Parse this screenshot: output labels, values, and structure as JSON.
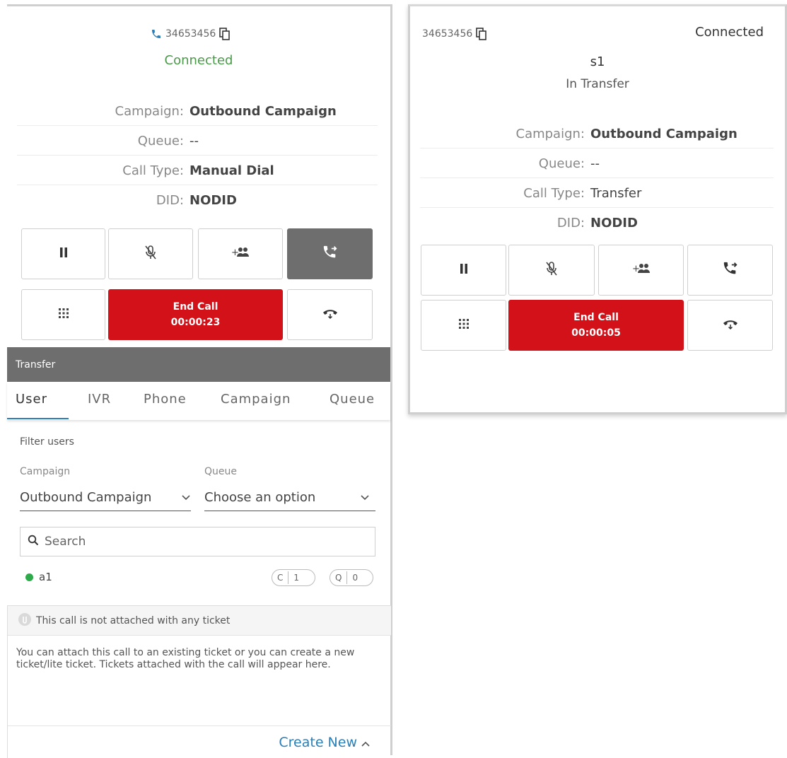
{
  "colors": {
    "connected": "#4a9a4a",
    "end_call": "#d31118",
    "accent": "#2a7fb8",
    "dark_button": "#6e6e6e",
    "online": "#2eaa4a"
  },
  "left": {
    "phone_number": "34653456",
    "status": "Connected",
    "info": [
      {
        "label": "Campaign:",
        "value": "Outbound Campaign"
      },
      {
        "label": "Queue:",
        "value": "--"
      },
      {
        "label": "Call Type:",
        "value": "Manual Dial"
      },
      {
        "label": "DID:",
        "value": "NODID"
      }
    ],
    "buttons": {
      "hold_icon": "pause-icon",
      "mute_icon": "mic-off-icon",
      "conference_icon": "add-users-icon",
      "transfer_icon": "call-transfer-icon",
      "dialpad_icon": "dialpad-icon",
      "hangup_icon": "hangup-icon"
    },
    "end_call": {
      "label": "End Call",
      "timer": "00:00:23"
    },
    "transfer": {
      "title": "Transfer",
      "tabs": [
        "User",
        "IVR",
        "Phone",
        "Campaign",
        "Queue"
      ],
      "filter_label": "Filter users",
      "campaign_label": "Campaign",
      "campaign_value": "Outbound Campaign",
      "queue_label": "Queue",
      "queue_value": "Choose an option",
      "search_placeholder": "Search",
      "user": {
        "name": "a1",
        "c_label": "C",
        "c_count": "1",
        "q_label": "Q",
        "q_count": "0"
      }
    },
    "ticket": {
      "notice": "This call is not attached with any ticket",
      "description": "You can attach this call to an existing ticket or you can create a new ticket/lite ticket. Tickets attached with the call will appear here.",
      "create_new": "Create New"
    }
  },
  "right": {
    "phone_number": "34653456",
    "status": "Connected",
    "user": "s1",
    "sub_status": "In Transfer",
    "info": [
      {
        "label": "Campaign:",
        "value": "Outbound Campaign"
      },
      {
        "label": "Queue:",
        "value": "--"
      },
      {
        "label": "Call Type:",
        "value": "Transfer"
      },
      {
        "label": "DID:",
        "value": "NODID"
      }
    ],
    "end_call": {
      "label": "End Call",
      "timer": "00:00:05"
    }
  }
}
